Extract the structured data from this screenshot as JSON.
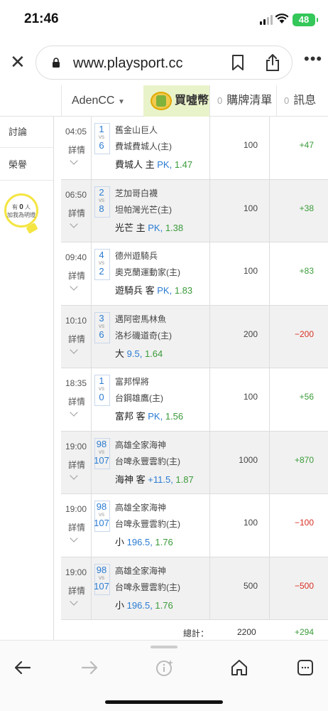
{
  "status": {
    "time": "21:46",
    "battery": "48"
  },
  "browser": {
    "url": "www.playsport.cc"
  },
  "nav": {
    "user": "AdenCC",
    "buy": "買噓幣",
    "cart_count": "0",
    "cart": "購牌清單",
    "msg_count": "0",
    "msg": "訊息"
  },
  "sidebar": {
    "discuss": "討論",
    "honor": "榮譽",
    "bulb_line1": "有",
    "bulb_count": "0",
    "bulb_unit": "人",
    "bulb_line2": "加我為明燈"
  },
  "colors": {
    "accent_blue": "#2a7bd3",
    "win_green": "#3a9b3a",
    "loss_red": "#d93025",
    "buy_bg": "#e9f3c9"
  },
  "rows": [
    {
      "time": "04:05",
      "detail": "詳情",
      "score_away": "1",
      "score_home": "6",
      "vs": "VS",
      "away": "舊金山巨人",
      "home": "費城費城人(主)",
      "pick_team": "費城人 主",
      "pick_line": "PK",
      "pick_odds": "1.47",
      "amount": "100",
      "result": "+47"
    },
    {
      "time": "06:50",
      "detail": "詳情",
      "score_away": "2",
      "score_home": "8",
      "vs": "VS",
      "away": "芝加哥白襪",
      "home": "坦帕灣光芒(主)",
      "pick_team": "光芒 主",
      "pick_line": "PK",
      "pick_odds": "1.38",
      "amount": "100",
      "result": "+38"
    },
    {
      "time": "09:40",
      "detail": "詳情",
      "score_away": "4",
      "score_home": "2",
      "vs": "VS",
      "away": "德州遊騎兵",
      "home": "奧克蘭運動家(主)",
      "pick_team": "遊騎兵 客",
      "pick_line": "PK",
      "pick_odds": "1.83",
      "amount": "100",
      "result": "+83"
    },
    {
      "time": "10:10",
      "detail": "詳情",
      "score_away": "3",
      "score_home": "6",
      "vs": "VS",
      "away": "邁阿密馬林魚",
      "home": "洛杉磯道奇(主)",
      "pick_team": "大",
      "pick_line": "9.5",
      "pick_odds": "1.64",
      "amount": "200",
      "result": "−200"
    },
    {
      "time": "18:35",
      "detail": "詳情",
      "score_away": "1",
      "score_home": "0",
      "vs": "VS",
      "away": "富邦悍將",
      "home": "台鋼雄鷹(主)",
      "pick_team": "富邦 客",
      "pick_line": "PK",
      "pick_odds": "1.56",
      "amount": "100",
      "result": "+56"
    },
    {
      "time": "19:00",
      "detail": "詳情",
      "score_away": "98",
      "score_home": "107",
      "vs": "VS",
      "away": "高雄全家海神",
      "home": "台啤永豐雲豹(主)",
      "pick_team": "海神 客",
      "pick_line": "+11.5",
      "pick_odds": "1.87",
      "amount": "1000",
      "result": "+870"
    },
    {
      "time": "19:00",
      "detail": "詳情",
      "score_away": "98",
      "score_home": "107",
      "vs": "VS",
      "away": "高雄全家海神",
      "home": "台啤永豐雲豹(主)",
      "pick_team": "小",
      "pick_line": "196.5",
      "pick_odds": "1.76",
      "amount": "100",
      "result": "−100"
    },
    {
      "time": "19:00",
      "detail": "詳情",
      "score_away": "98",
      "score_home": "107",
      "vs": "VS",
      "away": "高雄全家海神",
      "home": "台啤永豐雲豹(主)",
      "pick_team": "小",
      "pick_line": "196.5",
      "pick_odds": "1.76",
      "amount": "500",
      "result": "−500"
    }
  ],
  "totals": {
    "label": "總計：",
    "amount": "2200",
    "result": "+294"
  }
}
